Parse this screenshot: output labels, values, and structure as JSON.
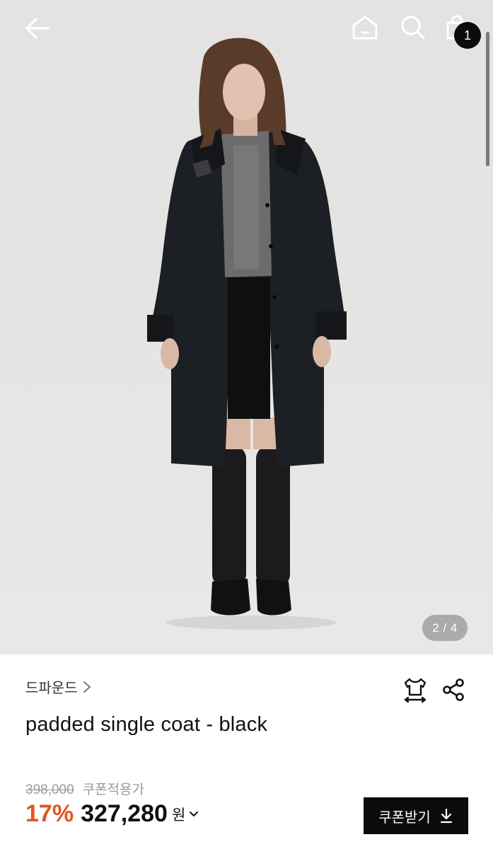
{
  "header": {
    "back_icon": "arrow-left-icon",
    "home_icon": "home-icon",
    "search_icon": "search-icon",
    "cart_icon": "shopping-bag-icon",
    "cart_count": "1"
  },
  "gallery": {
    "indicator": "2 / 4",
    "image_alt": "model wearing black padded single coat"
  },
  "product": {
    "brand": "드파운드",
    "name": "padded single coat - black",
    "original_price": "398,000",
    "coupon_note": "쿠폰적용가",
    "discount": "17%",
    "price": "327,280",
    "currency": "원"
  },
  "actions": {
    "size_icon": "size-guide-icon",
    "share_icon": "share-icon",
    "coupon_button": "쿠폰받기",
    "download_icon": "download-icon"
  },
  "colors": {
    "accent": "#e0561f",
    "dark": "#0b0b0b",
    "muted": "#9a9a9a"
  }
}
